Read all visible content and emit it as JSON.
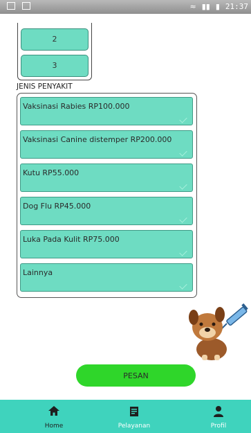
{
  "status_bar": {
    "time": "21:37"
  },
  "quantity_options": [
    "2",
    "3"
  ],
  "disease_section": {
    "label": "JENIS PENYAKIT",
    "options": [
      "Vaksinasi Rabies RP100.000",
      "Vaksinasi Canine distemper RP200.000",
      "Kutu RP55.000",
      "Dog Flu RP45.000",
      "Luka Pada Kulit RP75.000",
      "Lainnya"
    ]
  },
  "order_button": {
    "label": "PESAN"
  },
  "bottom_nav": {
    "items": [
      {
        "label": "Home",
        "icon": "home-icon",
        "active": true
      },
      {
        "label": "Pelayanan",
        "icon": "service-document-icon",
        "active": false
      },
      {
        "label": "Profil",
        "icon": "user-icon",
        "active": false
      }
    ]
  },
  "colors": {
    "option_fill": "#6edcc2",
    "button_green": "#2fd62a",
    "nav_bar": "#3fd3bd",
    "nav_active_text": "#1f1f1f",
    "nav_inactive_text": "#ffffff"
  }
}
